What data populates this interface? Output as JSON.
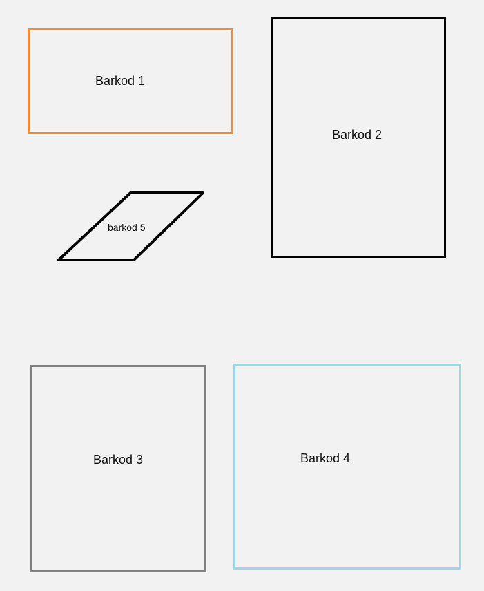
{
  "shapes": {
    "barkod1": {
      "label": "Barkod 1",
      "border_color": "#f08c37"
    },
    "barkod2": {
      "label": "Barkod 2",
      "border_color": "#000000"
    },
    "barkod3": {
      "label": "Barkod 3",
      "border_color": "#808080"
    },
    "barkod4": {
      "label": "Barkod 4",
      "border_color": "#9dd6e6"
    },
    "barkod5": {
      "label": "barkod 5",
      "border_color": "#000000",
      "shape": "parallelogram"
    }
  },
  "background_color": "#f2f2f2"
}
